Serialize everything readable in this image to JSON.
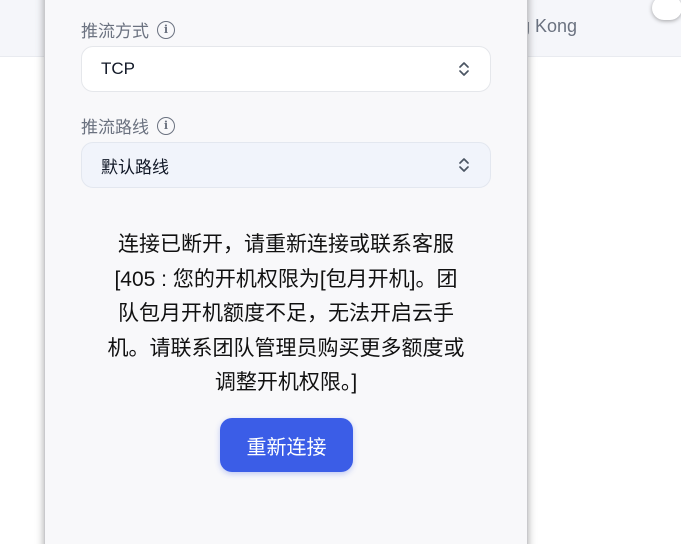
{
  "background": {
    "region_text": "ng Kong"
  },
  "panel": {
    "stream_mode": {
      "label": "推流方式",
      "value": "TCP"
    },
    "stream_route": {
      "label": "推流路线",
      "value": "默认路线"
    },
    "message": "连接已断开，请重新连接或联系客服\n[405 : 您的开机权限为[包月开机]。团\n队包月开机额度不足，无法开启云手\n机。请联系团队管理员购买更多额度或\n调整开机权限。]",
    "reconnect_label": "重新连接"
  },
  "icons": {
    "info": "info-icon",
    "select_arrows": "chevron-up-down-icon"
  },
  "colors": {
    "accent": "#3b5de7",
    "label": "#6b7280"
  }
}
